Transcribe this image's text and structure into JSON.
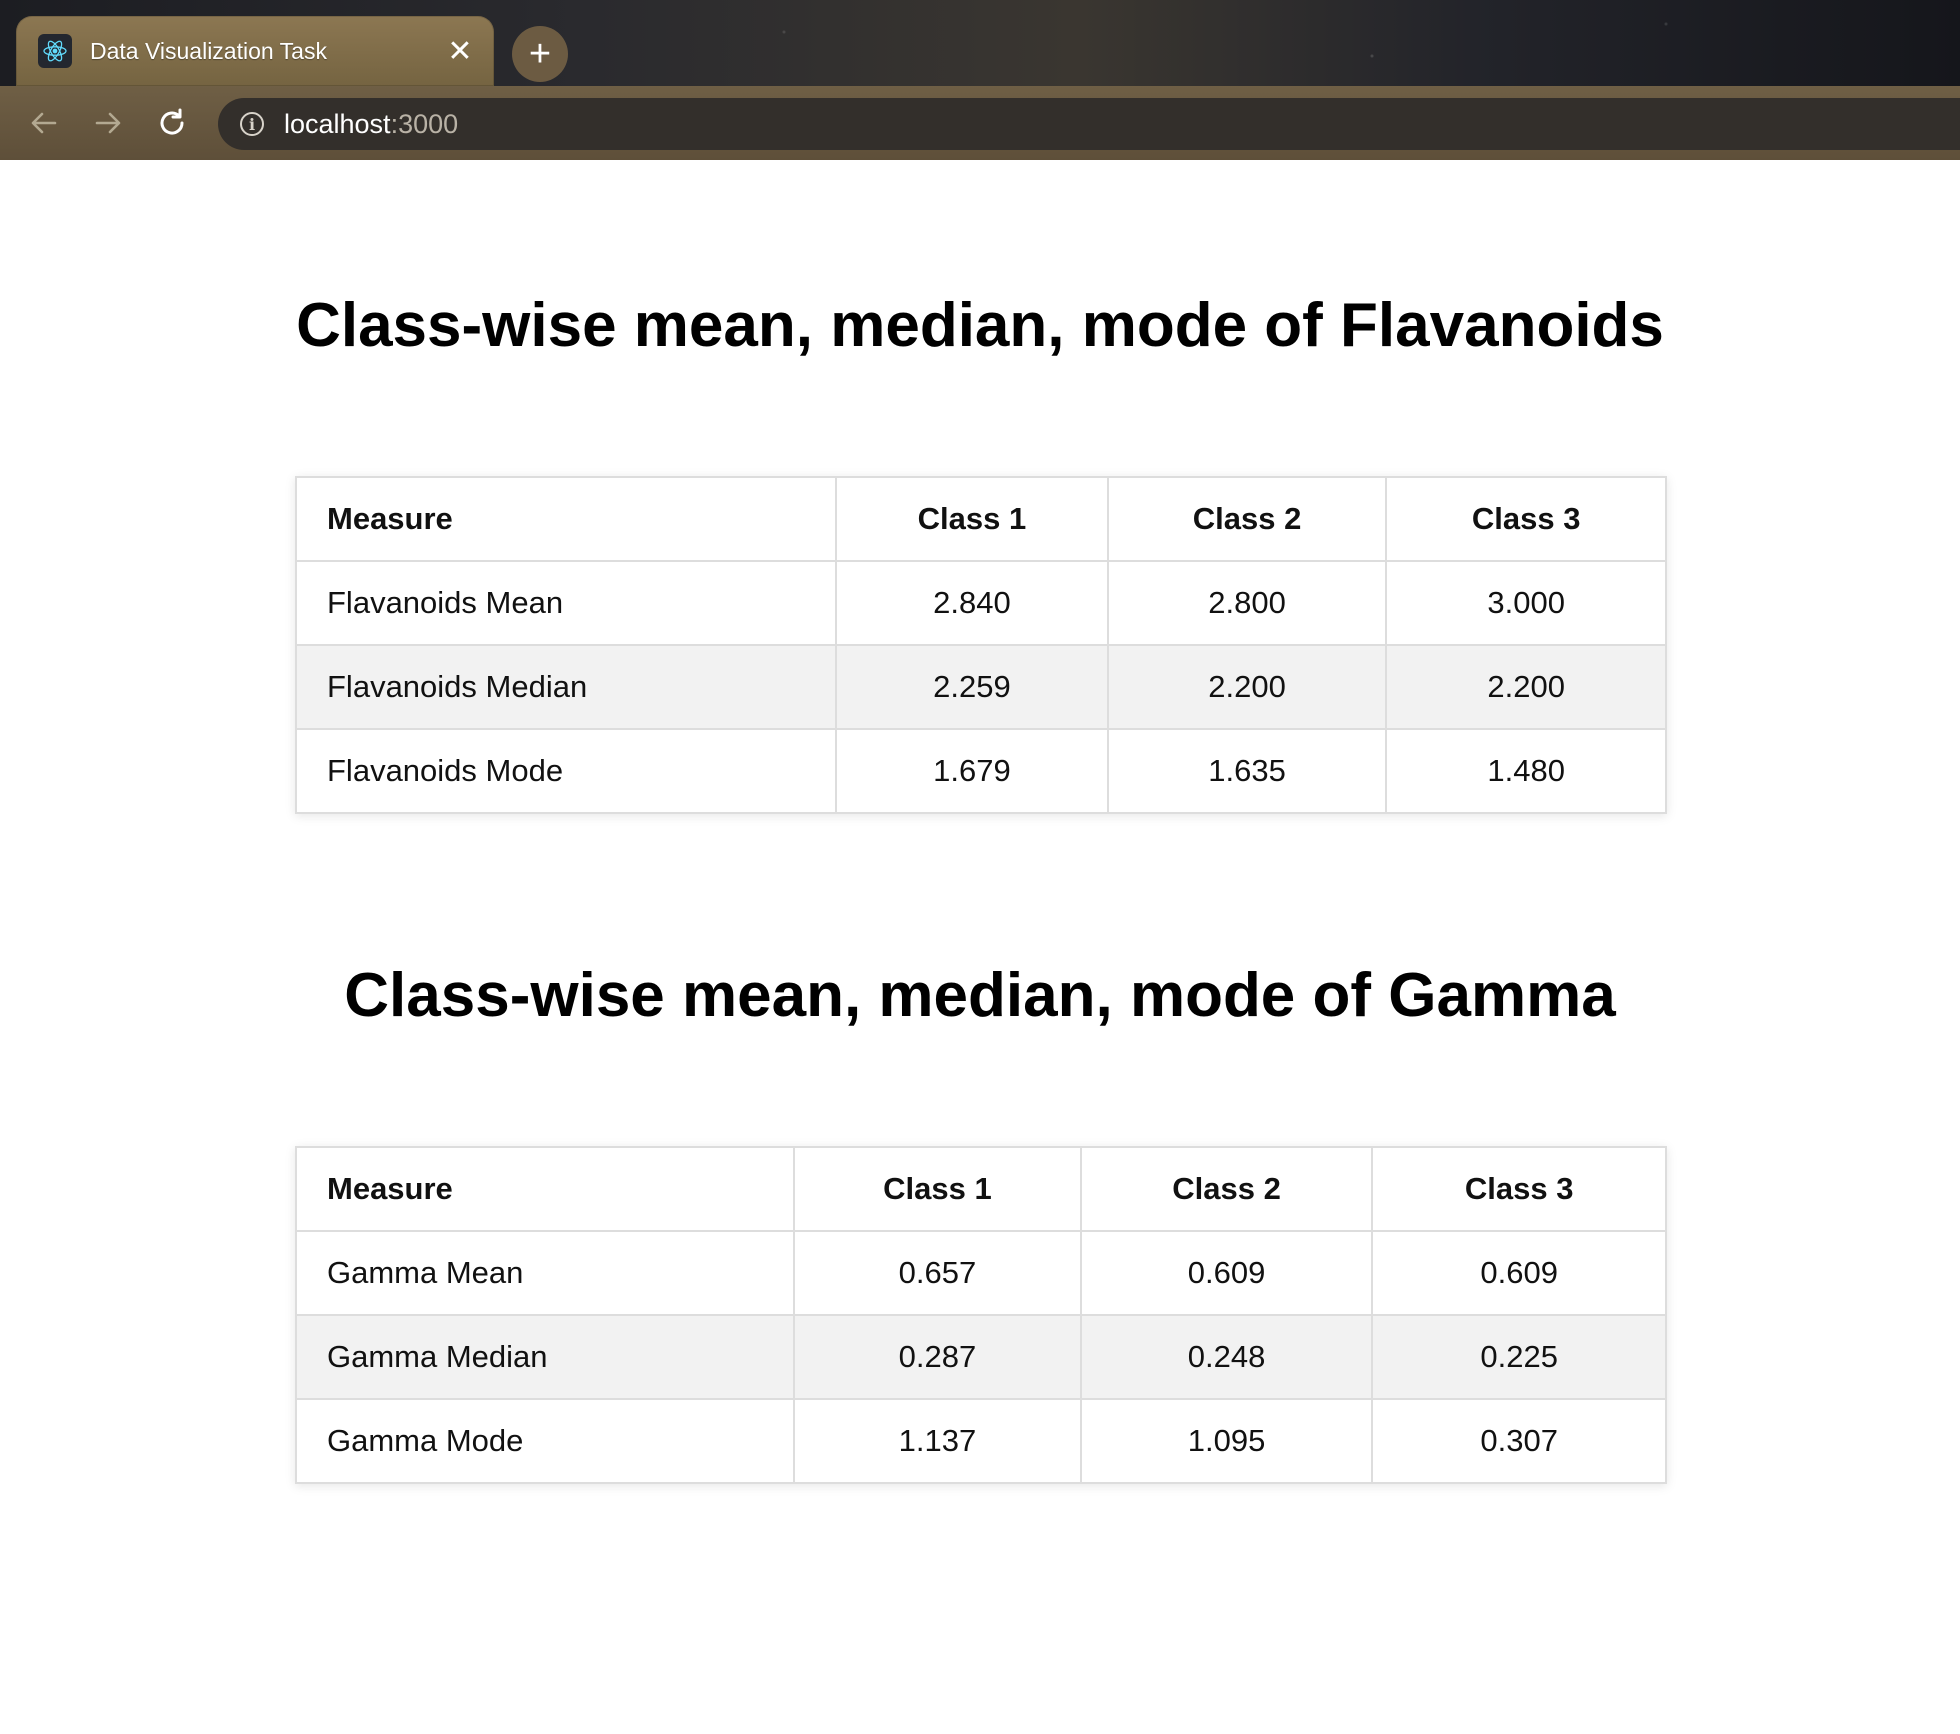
{
  "browser": {
    "tab_title": "Data Visualization Task",
    "url_host": "localhost",
    "url_port": ":3000",
    "icons": {
      "favicon": "react-atom-icon",
      "close": "close-icon",
      "new_tab": "plus-icon",
      "back": "arrow-left-icon",
      "forward": "arrow-right-icon",
      "reload": "reload-icon",
      "site_info": "info-icon"
    }
  },
  "flavanoids": {
    "title": "Class-wise mean, median, mode of Flavanoids",
    "headers": [
      "Measure",
      "Class 1",
      "Class 2",
      "Class 3"
    ],
    "rows": [
      {
        "label": "Flavanoids  Mean",
        "values": [
          "2.840",
          "2.800",
          "3.000"
        ]
      },
      {
        "label": "Flavanoids  Median",
        "values": [
          "2.259",
          "2.200",
          "2.200"
        ]
      },
      {
        "label": "Flavanoids  Mode",
        "values": [
          "1.679",
          "1.635",
          "1.480"
        ]
      }
    ]
  },
  "gamma": {
    "title": "Class-wise mean, median, mode of Gamma",
    "headers": [
      "Measure",
      "Class 1",
      "Class 2",
      "Class 3"
    ],
    "rows": [
      {
        "label": "Gamma  Mean",
        "values": [
          "0.657",
          "0.609",
          "0.609"
        ]
      },
      {
        "label": "Gamma  Median",
        "values": [
          "0.287",
          "0.248",
          "0.225"
        ]
      },
      {
        "label": "Gamma  Mode",
        "values": [
          "1.137",
          "1.095",
          "0.307"
        ]
      }
    ]
  },
  "colors": {
    "page_background": "#ffffff",
    "row_shade": "#f2f2f2",
    "cell_border": "#dddddd",
    "text": "#111111"
  }
}
